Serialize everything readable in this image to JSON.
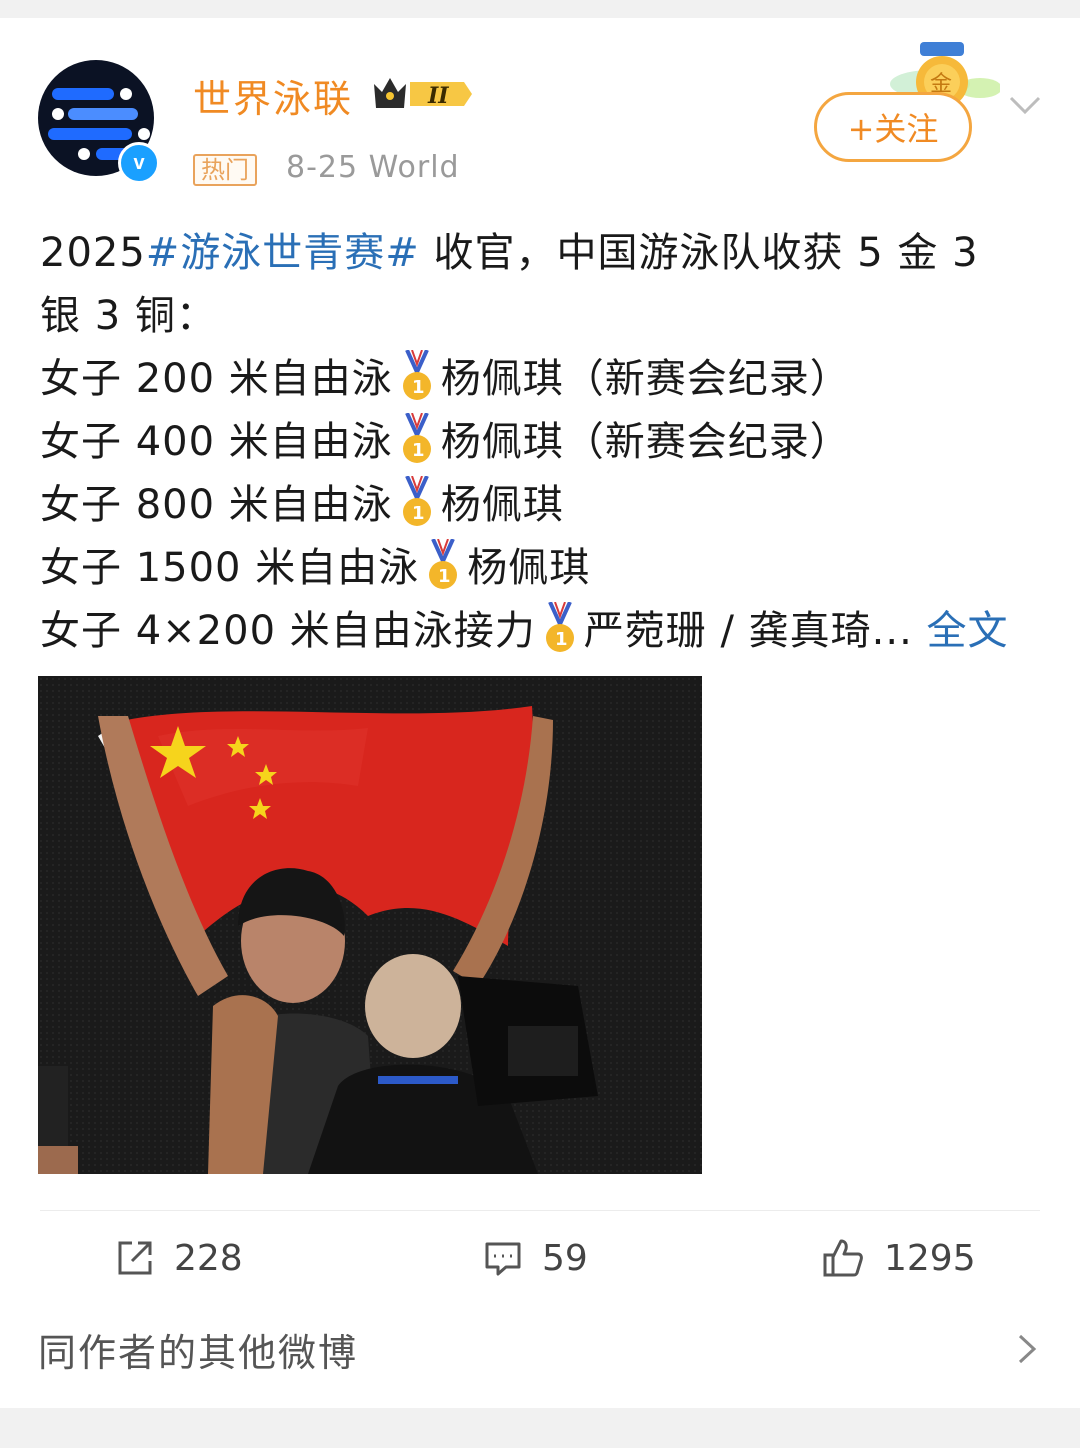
{
  "header": {
    "username": "世界泳联",
    "badge_level": "II",
    "hot_tag": "热门",
    "meta": "8-25  World",
    "follow_label": "+关注",
    "medal_badge_text": "金"
  },
  "post": {
    "line1_prefix": "2025",
    "line1_hashtag": "#游泳世青赛#",
    "line1_suffix": " 收官，中国游泳队收获 5 金 3",
    "line2": "银 3 铜：",
    "results": [
      {
        "event": "女子 200 米自由泳",
        "detail": "杨佩琪（新赛会纪录）"
      },
      {
        "event": "女子 400 米自由泳",
        "detail": "杨佩琪（新赛会纪录）"
      },
      {
        "event": "女子 800 米自由泳",
        "detail": "杨佩琪"
      },
      {
        "event": "女子 1500 米自由泳",
        "detail": "杨佩琪"
      },
      {
        "event": "女子 4×200 米自由泳接力",
        "detail": "严菀珊 / 龚真琦..."
      }
    ],
    "full_text_link": "全文",
    "photo_alt": "photo"
  },
  "actions": {
    "repost_count": "228",
    "comment_count": "59",
    "like_count": "1295"
  },
  "more": {
    "label": "同作者的其他微博"
  },
  "colors": {
    "username": "#f08a23",
    "link": "#2a6fb6",
    "follow_border": "#f4a640",
    "flag_red": "#d8261e",
    "flag_star": "#f6d41c"
  }
}
